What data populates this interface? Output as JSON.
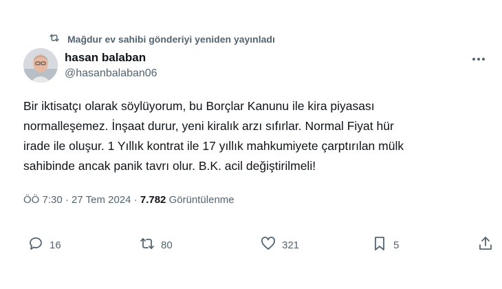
{
  "repost": {
    "icon": "repost-icon",
    "label": "Mağdur ev sahibi gönderiyi yeniden yayınladı"
  },
  "author": {
    "name": "hasan balaban",
    "handle": "@hasanbalaban06",
    "avatar": "profile-photo"
  },
  "tweet": {
    "lines": [
      "Bir iktisatçı olarak söylüyorum, bu Borçlar Kanunu ile kira piyasası",
      "normalleşemez. İnşaat durur, yeni kiralık arzı sıfırlar. Normal Fiyat hür",
      "irade ile oluşur. 1 Yıllık kontrat ile 17 yıllık mahkumiyete çarptırılan mülk",
      "sahibinde ancak panik tavrı olur. B.K. acil değiştirilmeli!"
    ]
  },
  "meta": {
    "time": "ÖÖ 7:30",
    "sep": "·",
    "date": "27 Tem 2024",
    "views": "7.782",
    "views_label": "Görüntülenme"
  },
  "actions": {
    "replies": "16",
    "reposts": "80",
    "likes": "321",
    "bookmarks": "5"
  },
  "colors": {
    "text": "#0f1419",
    "secondary": "#536471"
  }
}
